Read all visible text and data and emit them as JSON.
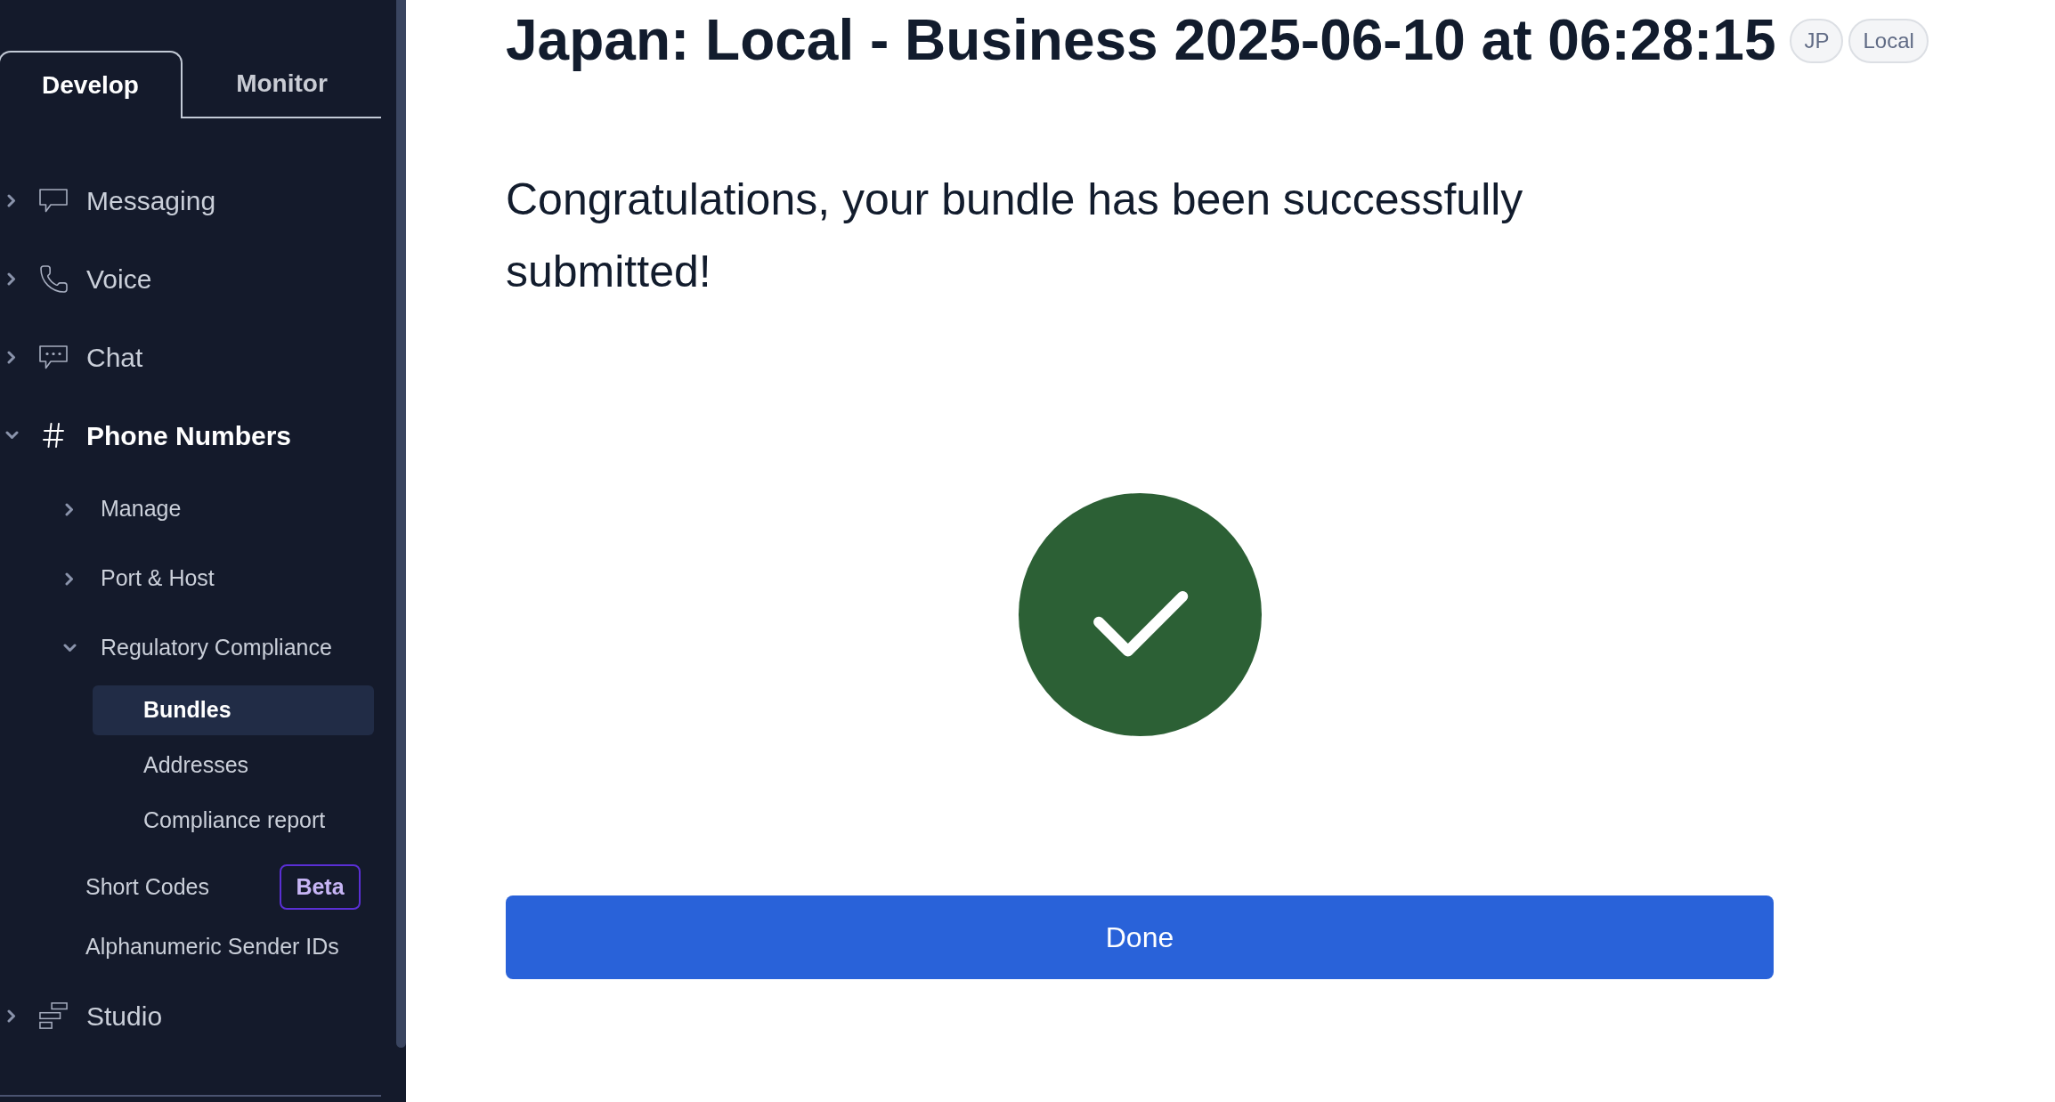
{
  "sidebar": {
    "tabs": [
      {
        "label": "Develop",
        "selected": true
      },
      {
        "label": "Monitor",
        "selected": false
      }
    ],
    "nav": [
      {
        "label": "Messaging",
        "expanded": false
      },
      {
        "label": "Voice",
        "expanded": false
      },
      {
        "label": "Chat",
        "expanded": false
      },
      {
        "label": "Phone Numbers",
        "expanded": true,
        "children": [
          {
            "kind": "group",
            "label": "Manage",
            "expanded": false
          },
          {
            "kind": "group",
            "label": "Port & Host",
            "expanded": false
          },
          {
            "kind": "group",
            "label": "Regulatory Compliance",
            "expanded": true,
            "children": [
              {
                "label": "Bundles",
                "selected": true
              },
              {
                "label": "Addresses",
                "selected": false
              },
              {
                "label": "Compliance report",
                "selected": false
              }
            ]
          },
          {
            "kind": "link",
            "label": "Short Codes",
            "selected": false,
            "badge": "Beta"
          },
          {
            "kind": "link",
            "label": "Alphanumeric Sender IDs",
            "selected": false
          }
        ]
      },
      {
        "label": "Studio",
        "expanded": false
      }
    ]
  },
  "page": {
    "title": "Japan: Local - Business 2025-06-10 at 06:28:15",
    "tags": [
      "JP",
      "Local"
    ],
    "message": "Congratulations, your bundle has been successfully submitted!",
    "button": "Done"
  }
}
